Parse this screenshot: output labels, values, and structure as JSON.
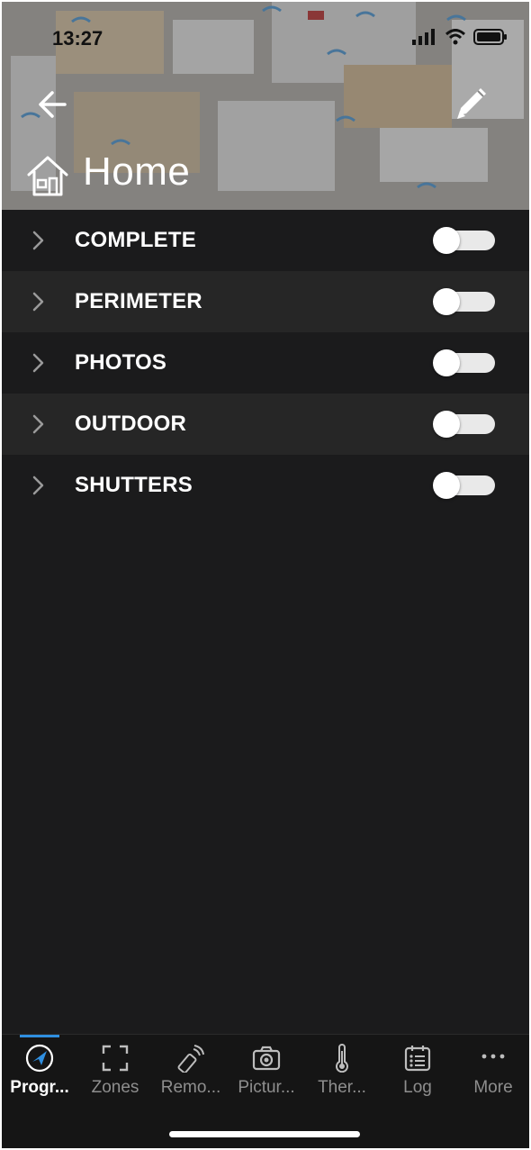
{
  "status_bar": {
    "time": "13:27"
  },
  "header": {
    "title": "Home"
  },
  "programs": [
    {
      "label": "COMPLETE",
      "enabled": false
    },
    {
      "label": "PERIMETER",
      "enabled": false
    },
    {
      "label": "PHOTOS",
      "enabled": false
    },
    {
      "label": "OUTDOOR",
      "enabled": false
    },
    {
      "label": "SHUTTERS",
      "enabled": false
    }
  ],
  "tabs": [
    {
      "label": "Progr...",
      "icon": "paper-plane-icon",
      "active": true
    },
    {
      "label": "Zones",
      "icon": "zones-frame-icon",
      "active": false
    },
    {
      "label": "Remo...",
      "icon": "remote-control-icon",
      "active": false
    },
    {
      "label": "Pictur...",
      "icon": "camera-icon",
      "active": false
    },
    {
      "label": "Ther...",
      "icon": "thermometer-icon",
      "active": false
    },
    {
      "label": "Log",
      "icon": "log-calendar-icon",
      "active": false
    },
    {
      "label": "More",
      "icon": "more-dots-icon",
      "active": false
    }
  ],
  "colors": {
    "accent": "#2f8fe0",
    "background": "#1b1b1c",
    "row_alt": "#262626"
  }
}
